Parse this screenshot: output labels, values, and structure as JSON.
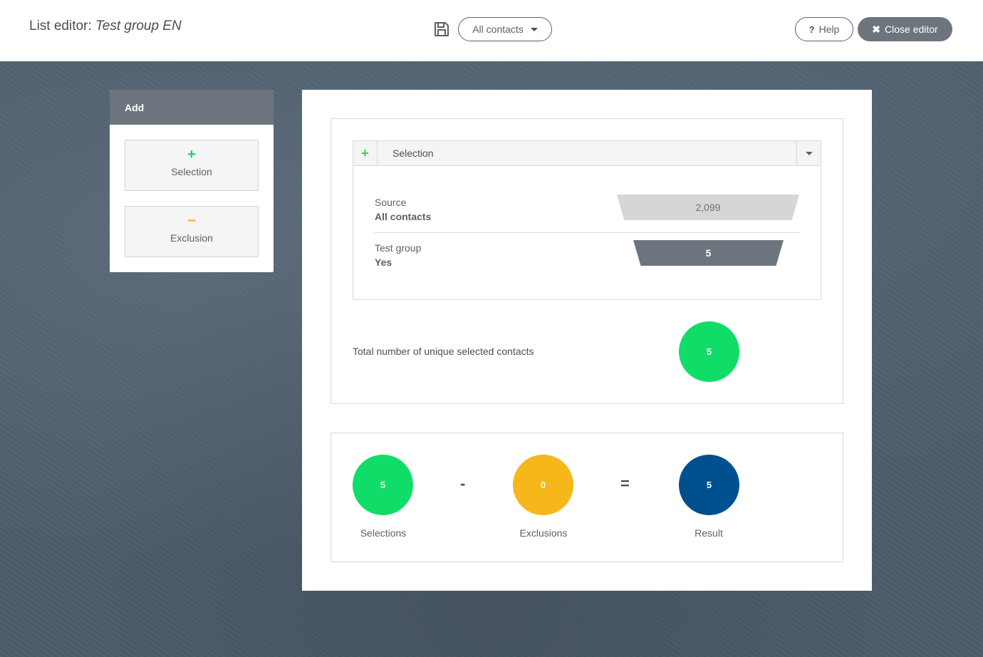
{
  "header": {
    "title_prefix": "List editor:",
    "title_name": "Test group EN",
    "save_icon": "floppy-disk-icon",
    "source_select": "All contacts",
    "help_label": "Help",
    "close_label": "Close editor"
  },
  "add_panel": {
    "title": "Add",
    "selection_symbol": "+",
    "selection_label": "Selection",
    "exclusion_symbol": "−",
    "exclusion_label": "Exclusion"
  },
  "selection_block": {
    "plus_symbol": "+",
    "title": "Selection",
    "rows": [
      {
        "label": "Source",
        "value": "All contacts",
        "count": "2,099"
      },
      {
        "label": "Test group",
        "value": "Yes",
        "count": "5"
      }
    ]
  },
  "total": {
    "label": "Total number of unique selected contacts",
    "value": "5"
  },
  "summary": {
    "selections_value": "5",
    "selections_label": "Selections",
    "minus_op": "-",
    "exclusions_value": "0",
    "exclusions_label": "Exclusions",
    "equals_op": "=",
    "result_value": "5",
    "result_label": "Result"
  },
  "colors": {
    "green": "#0fdd68",
    "yellow": "#f5b719",
    "blue": "#00508f",
    "gray": "#6c757d"
  }
}
